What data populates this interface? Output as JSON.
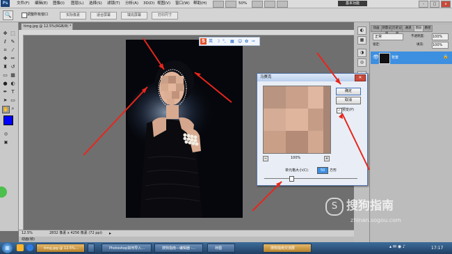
{
  "menubar": {
    "app_icon": "Ps",
    "items": [
      "文件(F)",
      "编辑(E)",
      "图像(I)",
      "图层(L)",
      "选择(S)",
      "滤镜(T)",
      "分析(A)",
      "3D(D)",
      "视图(V)",
      "窗口(W)",
      "帮助(H)"
    ],
    "zoom": "50%",
    "workspace": "基本功能",
    "window_buttons": [
      "-",
      "□",
      "x"
    ]
  },
  "optbar": {
    "checkbox_label": "调整所有窗口",
    "buttons": [
      "实际像素",
      "适合屏幕",
      "填充屏幕",
      "打印尺寸"
    ]
  },
  "document": {
    "tab_title": "timg.jpg @ 12.5%(RGB/8) *"
  },
  "sogou_toolbar": {
    "icon_names": [
      "sogou-s-icon",
      "chinese-mode-icon",
      "moon-icon",
      "punctuation-icon",
      "keyboard-icon",
      "user-icon",
      "wrench-icon"
    ],
    "label": "英"
  },
  "statusbar": {
    "zoom": "12.5%",
    "info": "2832 像素 x 4256 像素 (72 ppi)",
    "animation_label": "动画(帧)"
  },
  "panels": {
    "tabs": [
      "动画",
      "测量记录",
      "历史记录",
      "图层",
      "通道",
      "路径"
    ],
    "blend_mode": "正常",
    "opacity_label": "不透明度:",
    "opacity_value": "100%",
    "lock_label": "锁定:",
    "fill_label": "填充:",
    "fill_value": "100%",
    "layer_name": "背景"
  },
  "dialog": {
    "title": "马赛克",
    "ok": "确定",
    "cancel": "取消",
    "preview_label": "预览(P)",
    "preview_checked": true,
    "zoom": "100%",
    "cell_size_label": "单元格大小(C):",
    "cell_size_value": "50",
    "unit": "方形",
    "slider_level": 0.28
  },
  "taskbar": {
    "items": [
      "timg.jpg @ 12.5%...",
      "Photoshop如何导入...",
      "搜狗指南—编辑器 -...",
      "存图",
      "搜狗指南交流群"
    ],
    "time": "17:17"
  },
  "watermark": {
    "text": "搜狗指南",
    "url": "zhinan.sogou.com"
  },
  "colors": {
    "foreground": "#0000ff",
    "background": "#ffffff",
    "arrow": "#e8261b",
    "selection_highlight": "#3d8fe0"
  }
}
